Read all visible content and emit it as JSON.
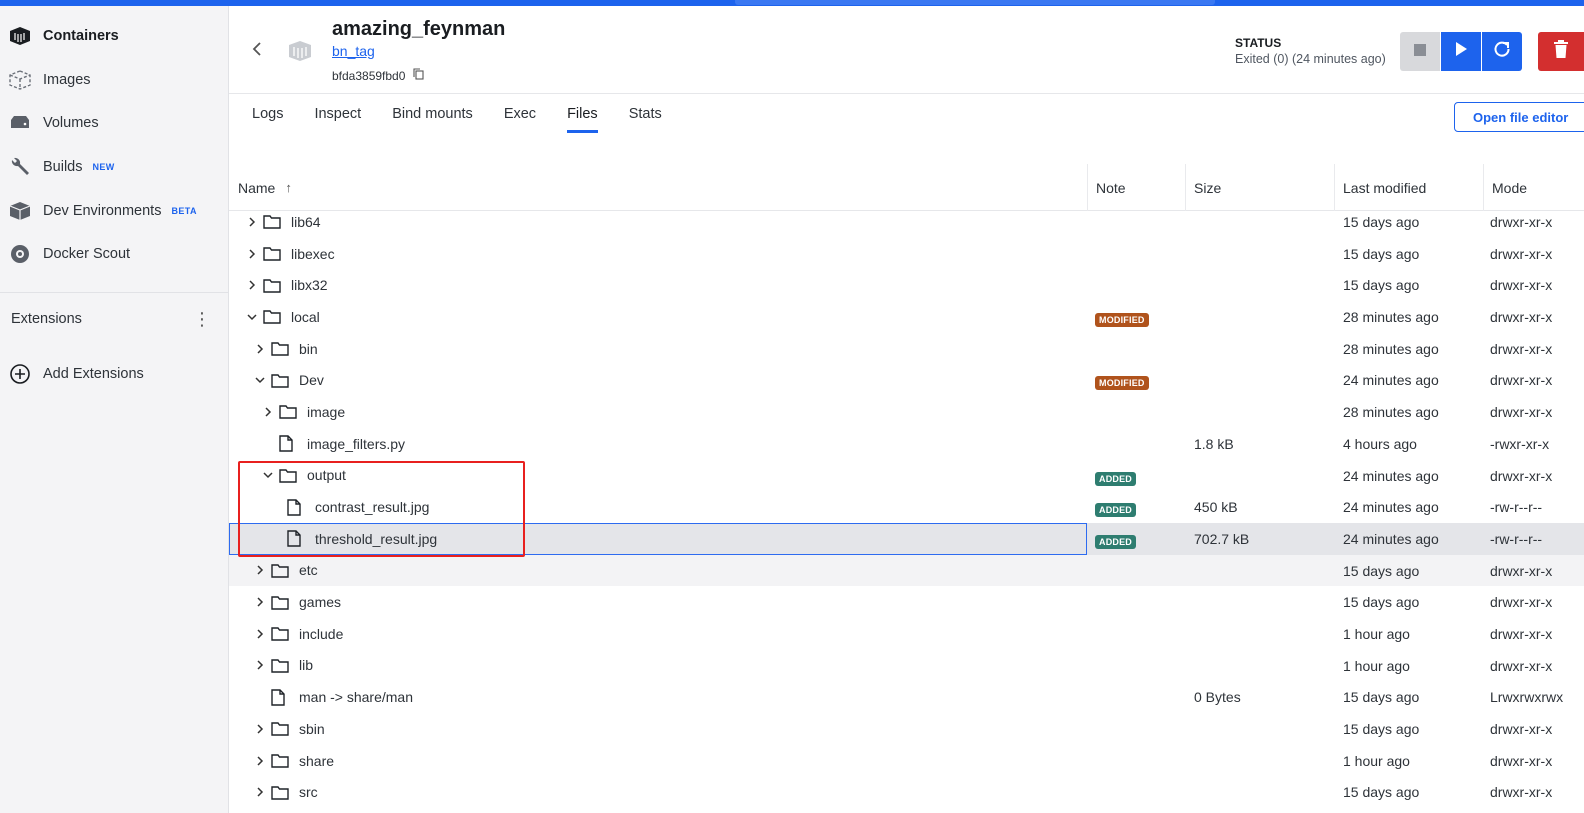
{
  "sidebar": {
    "items": [
      {
        "label": "Containers",
        "icon": "containers-icon",
        "active": true
      },
      {
        "label": "Images",
        "icon": "images-icon"
      },
      {
        "label": "Volumes",
        "icon": "volumes-icon"
      },
      {
        "label": "Builds",
        "icon": "builds-icon",
        "pill": "NEW"
      },
      {
        "label": "Dev Environments",
        "icon": "dev-environments-icon",
        "pill": "BETA"
      },
      {
        "label": "Docker Scout",
        "icon": "docker-scout-icon"
      }
    ],
    "extensions_label": "Extensions",
    "add_extensions_label": "Add Extensions"
  },
  "container": {
    "name": "amazing_feynman",
    "tag": "bn_tag",
    "id": "bfda3859fbd0",
    "status_label": "STATUS",
    "status_value": "Exited (0) (24 minutes ago)"
  },
  "tabs": [
    "Logs",
    "Inspect",
    "Bind mounts",
    "Exec",
    "Files",
    "Stats"
  ],
  "active_tab": "Files",
  "open_file_editor_label": "Open file editor",
  "table": {
    "columns": {
      "name": "Name",
      "note": "Note",
      "size": "Size",
      "modified": "Last modified",
      "mode": "Mode"
    },
    "rows": [
      {
        "name": "lib64",
        "type": "folder",
        "depth": 0,
        "expand": "collapsed",
        "note": "",
        "size": "",
        "modified": "15 days ago",
        "mode": "drwxr-xr-x"
      },
      {
        "name": "libexec",
        "type": "folder",
        "depth": 0,
        "expand": "collapsed",
        "note": "",
        "size": "",
        "modified": "15 days ago",
        "mode": "drwxr-xr-x"
      },
      {
        "name": "libx32",
        "type": "folder",
        "depth": 0,
        "expand": "collapsed",
        "note": "",
        "size": "",
        "modified": "15 days ago",
        "mode": "drwxr-xr-x"
      },
      {
        "name": "local",
        "type": "folder",
        "depth": 0,
        "expand": "expanded",
        "note": "MODIFIED",
        "size": "",
        "modified": "28 minutes ago",
        "mode": "drwxr-xr-x"
      },
      {
        "name": "bin",
        "type": "folder",
        "depth": 1,
        "expand": "collapsed",
        "note": "",
        "size": "",
        "modified": "28 minutes ago",
        "mode": "drwxr-xr-x"
      },
      {
        "name": "Dev",
        "type": "folder",
        "depth": 1,
        "expand": "expanded",
        "note": "MODIFIED",
        "size": "",
        "modified": "24 minutes ago",
        "mode": "drwxr-xr-x"
      },
      {
        "name": "image",
        "type": "folder",
        "depth": 2,
        "expand": "collapsed",
        "note": "",
        "size": "",
        "modified": "28 minutes ago",
        "mode": "drwxr-xr-x"
      },
      {
        "name": "image_filters.py",
        "type": "file",
        "depth": 2,
        "expand": "none",
        "note": "",
        "size": "1.8 kB",
        "modified": "4 hours ago",
        "mode": "-rwxr-xr-x"
      },
      {
        "name": "output",
        "type": "folder",
        "depth": 2,
        "expand": "expanded",
        "note": "ADDED",
        "size": "",
        "modified": "24 minutes ago",
        "mode": "drwxr-xr-x"
      },
      {
        "name": "contrast_result.jpg",
        "type": "file",
        "depth": 3,
        "expand": "none",
        "note": "ADDED",
        "size": "450 kB",
        "modified": "24 minutes ago",
        "mode": "-rw-r--r--"
      },
      {
        "name": "threshold_result.jpg",
        "type": "file",
        "depth": 3,
        "expand": "none",
        "note": "ADDED",
        "size": "702.7 kB",
        "modified": "24 minutes ago",
        "mode": "-rw-r--r--",
        "selected": true
      },
      {
        "name": "etc",
        "type": "folder",
        "depth": 1,
        "expand": "collapsed",
        "note": "",
        "size": "",
        "modified": "15 days ago",
        "mode": "drwxr-xr-x",
        "hover": true
      },
      {
        "name": "games",
        "type": "folder",
        "depth": 1,
        "expand": "collapsed",
        "note": "",
        "size": "",
        "modified": "15 days ago",
        "mode": "drwxr-xr-x"
      },
      {
        "name": "include",
        "type": "folder",
        "depth": 1,
        "expand": "collapsed",
        "note": "",
        "size": "",
        "modified": "1 hour ago",
        "mode": "drwxr-xr-x"
      },
      {
        "name": "lib",
        "type": "folder",
        "depth": 1,
        "expand": "collapsed",
        "note": "",
        "size": "",
        "modified": "1 hour ago",
        "mode": "drwxr-xr-x"
      },
      {
        "name": "man -> share/man",
        "type": "file",
        "depth": 1,
        "expand": "none",
        "note": "",
        "size": "0 Bytes",
        "modified": "15 days ago",
        "mode": "Lrwxrwxrwx"
      },
      {
        "name": "sbin",
        "type": "folder",
        "depth": 1,
        "expand": "collapsed",
        "note": "",
        "size": "",
        "modified": "15 days ago",
        "mode": "drwxr-xr-x"
      },
      {
        "name": "share",
        "type": "folder",
        "depth": 1,
        "expand": "collapsed",
        "note": "",
        "size": "",
        "modified": "1 hour ago",
        "mode": "drwxr-xr-x"
      },
      {
        "name": "src",
        "type": "folder",
        "depth": 1,
        "expand": "collapsed",
        "note": "",
        "size": "",
        "modified": "15 days ago",
        "mode": "drwxr-xr-x"
      }
    ]
  },
  "colors": {
    "accent": "#1d63ed",
    "modified_badge": "#b0531c",
    "added_badge": "#2e7d70",
    "delete": "#d32f2f",
    "annotation_box": "#e8201f"
  }
}
